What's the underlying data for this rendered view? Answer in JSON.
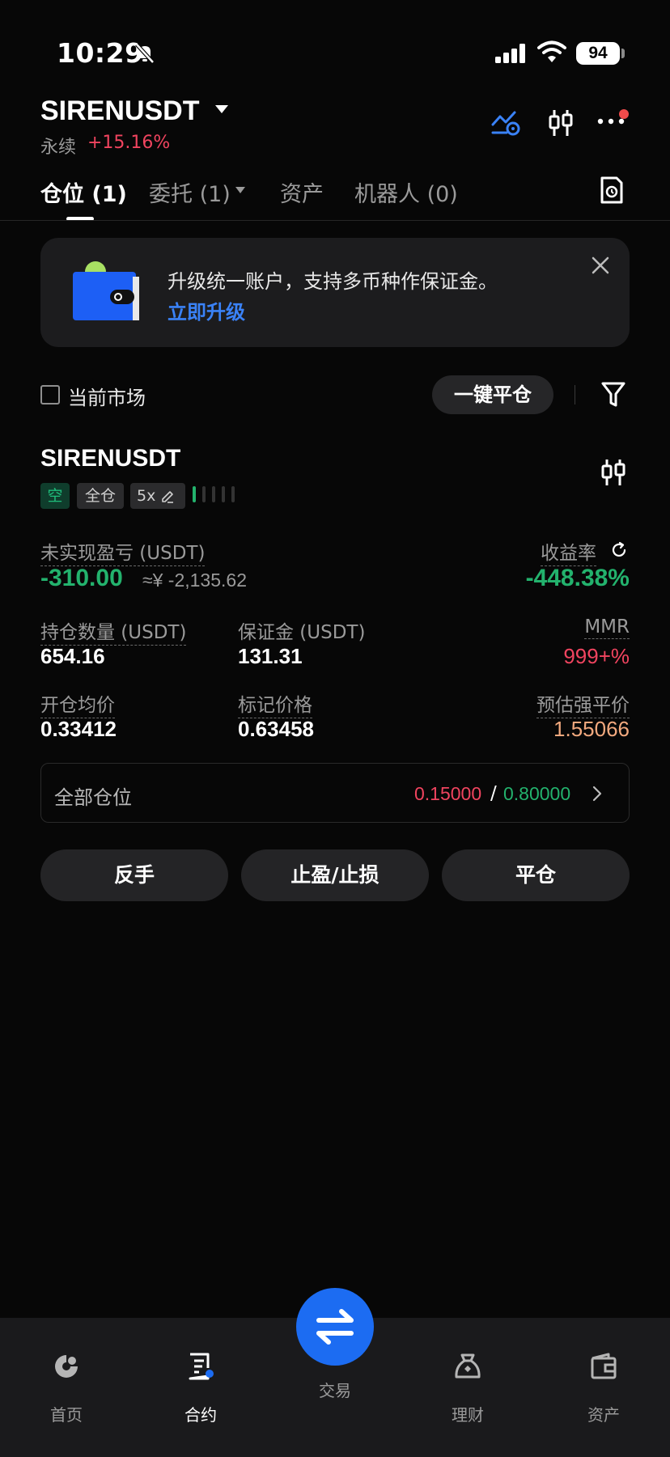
{
  "status_bar": {
    "time": "10:29",
    "battery": "94"
  },
  "header": {
    "symbol": "SIRENUSDT",
    "contract_type": "永续",
    "change": "+15.16%"
  },
  "tabs": [
    {
      "label": "仓位 (1)"
    },
    {
      "label": "委托 (1)"
    },
    {
      "label": "资产"
    },
    {
      "label": "机器人 (0)"
    }
  ],
  "banner": {
    "text": "升级统一账户，支持多币种作保证金。",
    "link": "立即升级"
  },
  "filter": {
    "current_market_label": "当前市场",
    "close_all_label": "一键平仓"
  },
  "position": {
    "symbol": "SIRENUSDT",
    "side": "空",
    "margin_mode": "全仓",
    "leverage": "5x",
    "unrealized_pnl_label": "未实现盈亏 (USDT)",
    "unrealized_pnl": "-310.00",
    "unrealized_pnl_cny": "≈¥ -2,135.62",
    "roe_label": "收益率",
    "roe": "-448.38%",
    "size_label": "持仓数量 (USDT)",
    "size": "654.16",
    "margin_label": "保证金 (USDT)",
    "margin": "131.31",
    "mmr_label": "MMR",
    "mmr": "999+%",
    "entry_price_label": "开仓均价",
    "entry_price": "0.33412",
    "mark_price_label": "标记价格",
    "mark_price": "0.63458",
    "liq_price_label": "预估强平价",
    "liq_price": "1.55066"
  },
  "all_positions": {
    "label": "全部仓位",
    "value_red": "0.15000",
    "separator": "/",
    "value_green": "0.80000"
  },
  "actions": {
    "reverse": "反手",
    "tp_sl": "止盈/止损",
    "close": "平仓"
  },
  "bottom_nav": {
    "home": "首页",
    "futures": "合约",
    "trade": "交易",
    "earn": "理财",
    "assets": "资产"
  },
  "colors": {
    "green": "#23b26d",
    "red": "#f0445f",
    "blue": "#1c6cf2",
    "orange": "#f2a97e"
  }
}
